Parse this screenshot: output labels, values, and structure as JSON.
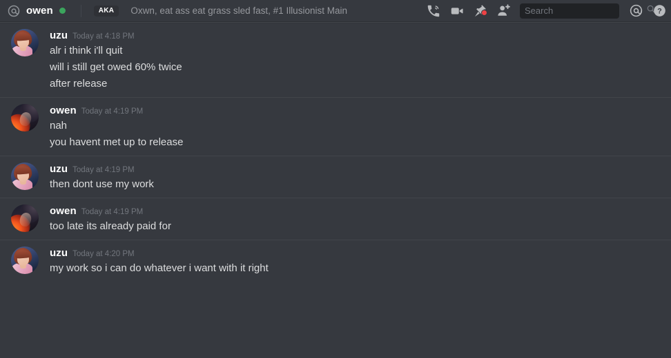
{
  "header": {
    "at_icon": "at-icon",
    "dm_name": "owen",
    "status": "online",
    "aka_label": "AKA",
    "custom_status": "Oxwn, eat ass eat grass sled fast, #1 Illusionist Main",
    "icons": [
      {
        "name": "voice-call-icon",
        "label": "Start Voice Call"
      },
      {
        "name": "video-call-icon",
        "label": "Start Video Call"
      },
      {
        "name": "pinned-messages-icon",
        "label": "Pinned Messages",
        "badge": true
      },
      {
        "name": "add-friends-icon",
        "label": "Add Friends to DM"
      },
      {
        "name": "mentions-icon",
        "label": "Inbox"
      },
      {
        "name": "help-icon",
        "label": "Help"
      }
    ]
  },
  "search": {
    "placeholder": "Search",
    "value": "",
    "icon": "search-icon"
  },
  "colors": {
    "background": "#36393f",
    "header_divider": "#2c2f34",
    "message_divider": "#42454a",
    "text": "#dcddde",
    "username": "#ffffff",
    "timestamp": "#72767d",
    "online_green": "#3ba55d",
    "badge_red": "#ed4245",
    "search_bg": "#202225"
  },
  "messages": [
    {
      "author": "uzu",
      "avatar": "uzu-avatar",
      "timestamp": "Today at 4:18 PM",
      "lines": [
        "alr i think i'll quit",
        "will i still get owed 60% twice",
        "after release"
      ]
    },
    {
      "author": "owen",
      "avatar": "owen-avatar",
      "timestamp": "Today at 4:19 PM",
      "lines": [
        "nah",
        "you havent met up to release"
      ]
    },
    {
      "author": "uzu",
      "avatar": "uzu-avatar",
      "timestamp": "Today at 4:19 PM",
      "lines": [
        "then dont use my work"
      ]
    },
    {
      "author": "owen",
      "avatar": "owen-avatar",
      "timestamp": "Today at 4:19 PM",
      "lines": [
        "too late its already paid for"
      ]
    },
    {
      "author": "uzu",
      "avatar": "uzu-avatar",
      "timestamp": "Today at 4:20 PM",
      "lines": [
        "my work so i can do whatever i want with it right"
      ]
    }
  ]
}
